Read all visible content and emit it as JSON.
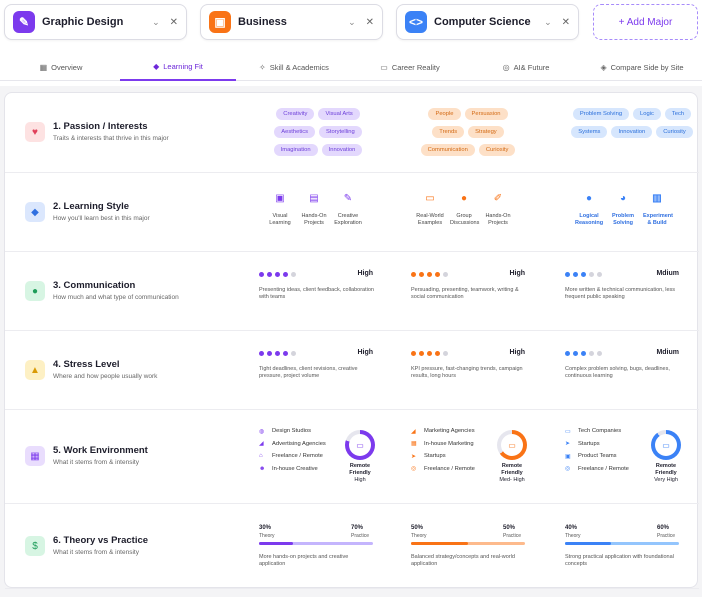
{
  "majors": [
    {
      "name": "Graphic Design",
      "icon": "design-icon",
      "color": "#7c3aed"
    },
    {
      "name": "Business",
      "icon": "briefcase-icon",
      "color": "#f97316"
    },
    {
      "name": "Computer Science",
      "icon": "code-icon",
      "color": "#3b82f6"
    }
  ],
  "add_major": "+ Add Major",
  "tabs": [
    "Overview",
    "Learning Fit",
    "Skill & Academics",
    "Career Reality",
    "AI& Future",
    "Compare Side by Site"
  ],
  "rows": [
    {
      "title": "1. Passion / Interests",
      "sub": "Traits & interests that thrive in this major"
    },
    {
      "title": "2. Learning Style",
      "sub": "How you'll learn best in this major"
    },
    {
      "title": "3. Communication",
      "sub": "How much and what type of communication"
    },
    {
      "title": "4. Stress Level",
      "sub": "Where and how people usually work"
    },
    {
      "title": "5. Work Environment",
      "sub": "What it stems from & intensity"
    },
    {
      "title": "6. Theory vs Practice",
      "sub": "What it stems from & intensity"
    }
  ],
  "passion": [
    [
      "Creativity",
      "Visual Arts",
      "Aesthetics",
      "Storytelling",
      "Imagination",
      "Innovation"
    ],
    [
      "People",
      "Persuasion",
      "Trends",
      "Strategy",
      "Communication",
      "Curiosity"
    ],
    [
      "Problem Solving",
      "Logic",
      "Tech",
      "Systems",
      "Innovation",
      "Curiosity"
    ]
  ],
  "learning": [
    [
      "Visual Learning",
      "Hands-On Projects",
      "Creative Exploration"
    ],
    [
      "Real-World Examples",
      "Group Discussions",
      "Hands-On Projects"
    ],
    [
      "Logical Reasoning",
      "Problem Solving",
      "Experiment & Build"
    ]
  ],
  "communication": [
    {
      "level": "High",
      "filled": 4,
      "desc": "Presenting ideas, client feedback, collaboration with teams"
    },
    {
      "level": "High",
      "filled": 4,
      "desc": "Persuading, presenting, teamwork, writing & social communication"
    },
    {
      "level": "Mdium",
      "filled": 3,
      "desc": "More written & technical communication, less frequent public speaking"
    }
  ],
  "stress": [
    {
      "level": "High",
      "filled": 4,
      "desc": "Tight deadlines, client revisions, creative pressure, project volume"
    },
    {
      "level": "High",
      "filled": 4,
      "desc": "KPI pressure, fast-changing trends, campaign results, long hours"
    },
    {
      "level": "Mdium",
      "filled": 3,
      "desc": "Complex problem solving, bugs, deadlines, continuous learning"
    }
  ],
  "work": [
    {
      "items": [
        "Design Studios",
        "Advertising Agencies",
        "Freelance / Remote",
        "In-house Creative"
      ],
      "remote_label": "Remote Friendly",
      "remote_level": "High",
      "remote_pct": 0.8
    },
    {
      "items": [
        "Marketing Agencies",
        "In-house Marketing",
        "Startups",
        "Freelance / Remote"
      ],
      "remote_label": "Remote Friendly",
      "remote_level": "Med- High",
      "remote_pct": 0.65
    },
    {
      "items": [
        "Tech Companies",
        "Startups",
        "Product Teams",
        "Freelance / Remote"
      ],
      "remote_label": "Remote Friendly",
      "remote_level": "Very High",
      "remote_pct": 0.9
    }
  ],
  "theory": [
    {
      "theory_pct": "30%",
      "practice_pct": "70%",
      "theory": 30,
      "desc": "More hands-on projects and creative application"
    },
    {
      "theory_pct": "50%",
      "practice_pct": "50%",
      "theory": 50,
      "desc": "Balanced strategy/concepts and real-world application"
    },
    {
      "theory_pct": "40%",
      "practice_pct": "60%",
      "theory": 40,
      "desc": "Strong practical application with foundational concepts"
    }
  ],
  "theory_label": "Theory",
  "practice_label": "Practice"
}
